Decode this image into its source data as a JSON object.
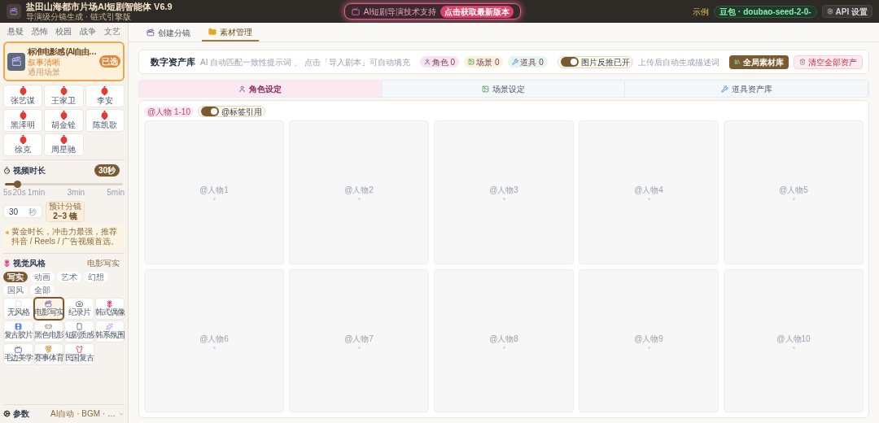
{
  "header": {
    "title": "盐田山海都市片场AI短剧智能体 V6.9",
    "subtitle": "导演级分镜生成 · 链式引擎版",
    "promo": "AI短剧导演技术支持",
    "promo_button": "点击获取最新版本",
    "example_label": "示例",
    "model": "豆包 · doubao-seed-2-0-",
    "api_button": "API 设置"
  },
  "sidebar": {
    "genres": [
      "悬疑",
      "恐怖",
      "校园",
      "战争",
      "文艺"
    ],
    "preset": {
      "title": "标准电影感 (AI自由…",
      "subtitle": "叙事清晰",
      "tag": "通用场景",
      "badge": "已选"
    },
    "directors": [
      "张艺谋",
      "王家卫",
      "李安",
      "黑泽明",
      "胡金铨",
      "陈凯歌",
      "徐克",
      "周星驰"
    ],
    "duration": {
      "title": "视频时长",
      "badge": "30秒",
      "level": 0.1,
      "ticks": [
        "5s",
        "20s",
        "1min",
        "3min",
        "5min"
      ],
      "value": "30",
      "unit": "秒",
      "estimate_label": "预计分镜",
      "estimate": "2–3 镜",
      "tip": "黄金时长，冲击力最强，推荐抖音 / Reels / 广告视频首选。"
    },
    "style": {
      "title": "视觉风格",
      "current": "电影写实",
      "filters": [
        {
          "label": "写实",
          "selected": true
        },
        {
          "label": "动画",
          "selected": false
        },
        {
          "label": "艺术",
          "selected": false
        },
        {
          "label": "幻想",
          "selected": false
        },
        {
          "label": "国风",
          "selected": false
        },
        {
          "label": "全部",
          "selected": false
        }
      ],
      "items": [
        {
          "label": "无风格",
          "selected": false,
          "kind": "none"
        },
        {
          "label": "电影写实",
          "selected": true,
          "kind": "film"
        },
        {
          "label": "纪录片",
          "selected": false,
          "kind": "camera"
        },
        {
          "label": "韩式偶像",
          "selected": false,
          "kind": "flower"
        },
        {
          "label": "复古胶片",
          "selected": false,
          "kind": "reel"
        },
        {
          "label": "黑色电影",
          "selected": false,
          "kind": "detective"
        },
        {
          "label": "短剧质感",
          "selected": false,
          "kind": "phone"
        },
        {
          "label": "韩系氛围",
          "selected": false,
          "kind": "sparkle"
        },
        {
          "label": "毛边美学",
          "selected": false,
          "kind": "tape"
        },
        {
          "label": "赛事体育",
          "selected": false,
          "kind": "medal"
        },
        {
          "label": "民国复古",
          "selected": false,
          "kind": "dress"
        }
      ]
    },
    "params": {
      "title": "参数",
      "summary": "AI自动 · BGM · …"
    }
  },
  "main": {
    "tabs": [
      {
        "label": "创建分镜",
        "selected": false
      },
      {
        "label": "素材管理",
        "selected": true
      }
    ],
    "library": {
      "title": "数字资产库",
      "hint": "AI 自动匹配一致性提示词 、 点击「导入剧本」可自动填充",
      "counts": [
        {
          "label": "角色 0",
          "color": "#f9e4ee"
        },
        {
          "label": "场景 0",
          "color": "#fbf3d9"
        },
        {
          "label": "道具 0",
          "color": "#e3f5ec"
        }
      ],
      "toggle": {
        "label": "图片反推已开",
        "on": true
      },
      "toggle_hint": "上传后自动生成描述词",
      "global_button": "全局素材库",
      "clear_button": "清空全部资产"
    },
    "subtabs": [
      {
        "label": "角色设定",
        "selected": true
      },
      {
        "label": "场景设定",
        "selected": false
      },
      {
        "label": "道具资产库",
        "selected": false
      }
    ],
    "range_chip": "@人物 1-10",
    "tag_toggle": {
      "label": "@标签引用",
      "on": true
    },
    "slots": [
      "@人物1",
      "@人物2",
      "@人物3",
      "@人物4",
      "@人物5",
      "@人物6",
      "@人物7",
      "@人物8",
      "@人物9",
      "@人物10"
    ]
  }
}
